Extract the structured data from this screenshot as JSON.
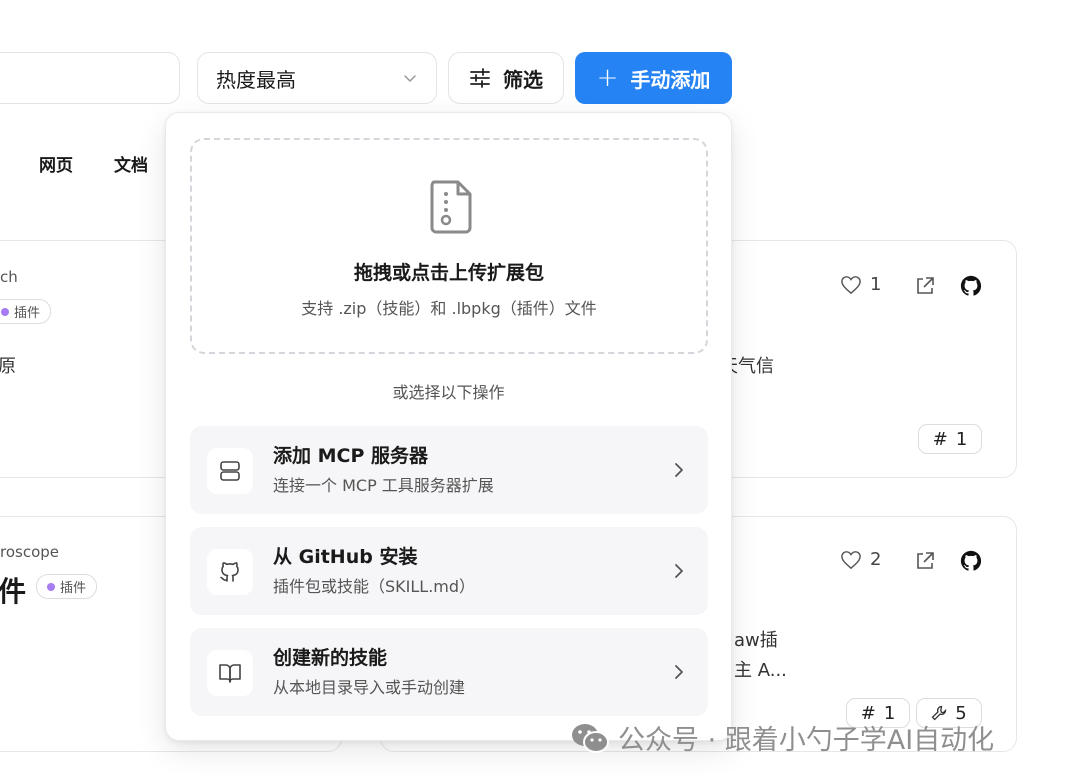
{
  "toolbar": {
    "sort_label": "热度最高",
    "filter_label": "筛选",
    "add_label": "手动添加"
  },
  "tabs": [
    "网页",
    "文档"
  ],
  "cards": {
    "top_left": {
      "name_fragment": "ch",
      "badge": "插件",
      "desc_fragment": "原"
    },
    "top_right": {
      "likes": "1",
      "desc_fragment": "天气信",
      "tag_count": "1"
    },
    "bottom_left": {
      "name_fragment": "roscope",
      "title_fragment": "件",
      "badge": "插件"
    },
    "bottom_right": {
      "likes": "2",
      "desc_line1": "aw插",
      "desc_line2": "主 A...",
      "tag_count": "1",
      "tool_count": "5"
    }
  },
  "panel": {
    "upload_title": "拖拽或点击上传扩展包",
    "upload_subtitle": "支持 .zip（技能）和 .lbpkg（插件）文件",
    "divider": "或选择以下操作",
    "options": [
      {
        "title": "添加 MCP 服务器",
        "subtitle": "连接一个 MCP 工具服务器扩展",
        "icon": "server-icon"
      },
      {
        "title": "从 GitHub 安装",
        "subtitle": "插件包或技能（SKILL.md）",
        "icon": "github-icon"
      },
      {
        "title": "创建新的技能",
        "subtitle": "从本地目录导入或手动创建",
        "icon": "book-icon"
      }
    ]
  },
  "watermark": "公众号 · 跟着小勺子学AI自动化",
  "colors": {
    "primary": "#2583f3",
    "plugin_dot": "#a57cf2"
  }
}
